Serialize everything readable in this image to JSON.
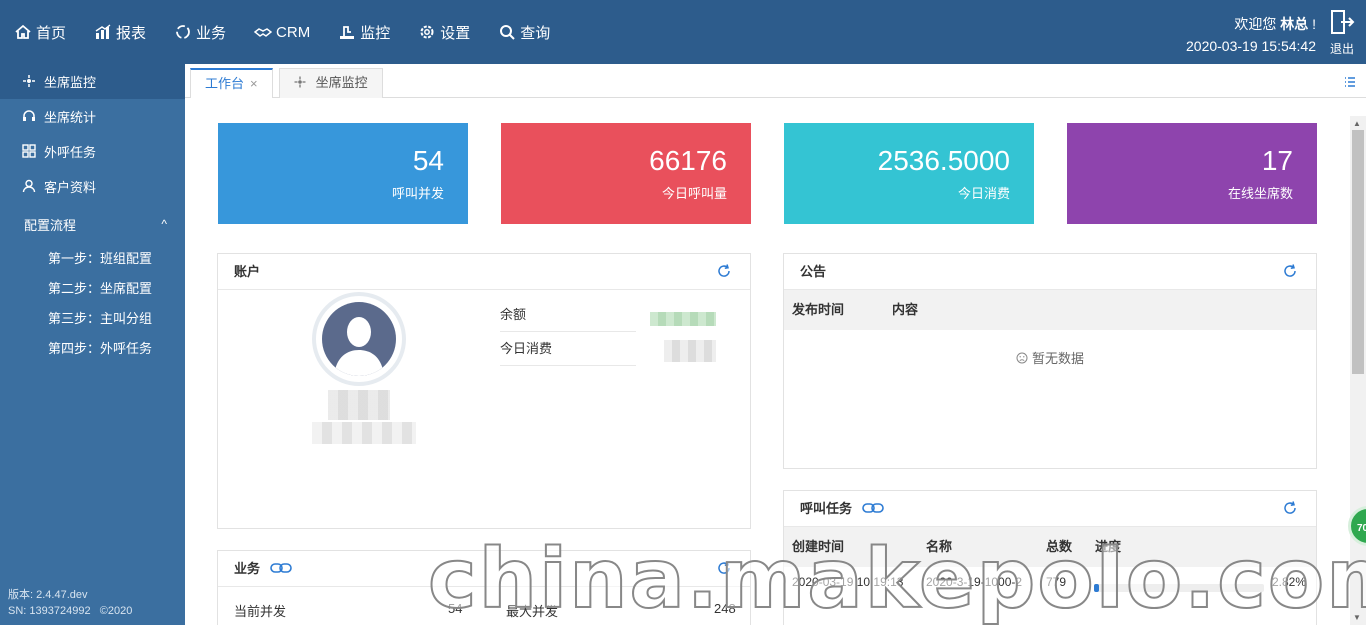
{
  "header": {
    "nav": [
      {
        "label": "首页",
        "icon": "home-icon"
      },
      {
        "label": "报表",
        "icon": "chart-icon"
      },
      {
        "label": "业务",
        "icon": "cycle-icon"
      },
      {
        "label": "CRM",
        "icon": "handshake-icon"
      },
      {
        "label": "监控",
        "icon": "monitor-icon"
      },
      {
        "label": "设置",
        "icon": "gear-icon"
      },
      {
        "label": "查询",
        "icon": "search-icon"
      }
    ],
    "welcome_prefix": "欢迎您",
    "user_name": "林总",
    "welcome_suffix": "!",
    "datetime": "2020-03-19 15:54:42",
    "logout_label": "退出"
  },
  "sidebar": {
    "items": [
      {
        "label": "坐席监控",
        "icon": "agent-monitor-icon",
        "active": true
      },
      {
        "label": "坐席统计",
        "icon": "headset-icon"
      },
      {
        "label": "外呼任务",
        "icon": "grid-icon"
      },
      {
        "label": "客户资料",
        "icon": "user-icon"
      }
    ],
    "group_label": "配置流程",
    "group_chevron": "^",
    "sub_items": [
      "第一步：班组配置",
      "第二步：坐席配置",
      "第三步：主叫分组",
      "第四步：外呼任务"
    ],
    "version": "版本: 2.4.47.dev",
    "sn": "SN: 1393724992",
    "copyright": "©2020"
  },
  "tabs": [
    {
      "label": "工作台",
      "active": true,
      "close": "×"
    },
    {
      "label": "坐席监控",
      "active": false
    }
  ],
  "stats": [
    {
      "value": "54",
      "label": "呼叫并发",
      "color": "#3797db"
    },
    {
      "value": "66176",
      "label": "今日呼叫量",
      "color": "#e9505c"
    },
    {
      "value": "2536.5000",
      "label": "今日消费",
      "color": "#34c4d3"
    },
    {
      "value": "17",
      "label": "在线坐席数",
      "color": "#8e44ad"
    }
  ],
  "account": {
    "title": "账户",
    "balance_label": "余额",
    "today_cost_label": "今日消费"
  },
  "notice": {
    "title": "公告",
    "col_time": "发布时间",
    "col_content": "内容",
    "empty_text": "暂无数据"
  },
  "tasks": {
    "title": "呼叫任务",
    "col_created": "创建时间",
    "col_name": "名称",
    "col_total": "总数",
    "col_progress": "进度",
    "row": {
      "created": "2020-03-19 10:19:13",
      "name": "2020-3-19-1000-2",
      "total": "779",
      "progress": 0.0282,
      "progress_text": "2.82%"
    }
  },
  "business": {
    "title": "业务",
    "current_label": "当前并发",
    "current_value": "54",
    "max_label": "最大并发",
    "max_value": "248"
  },
  "float_badge": "70",
  "watermark": "china.makepolo.com",
  "colors": {
    "header_bg": "#2d5c8c",
    "sidebar_bg": "#3b6fa0",
    "accent": "#2d7bd3"
  }
}
